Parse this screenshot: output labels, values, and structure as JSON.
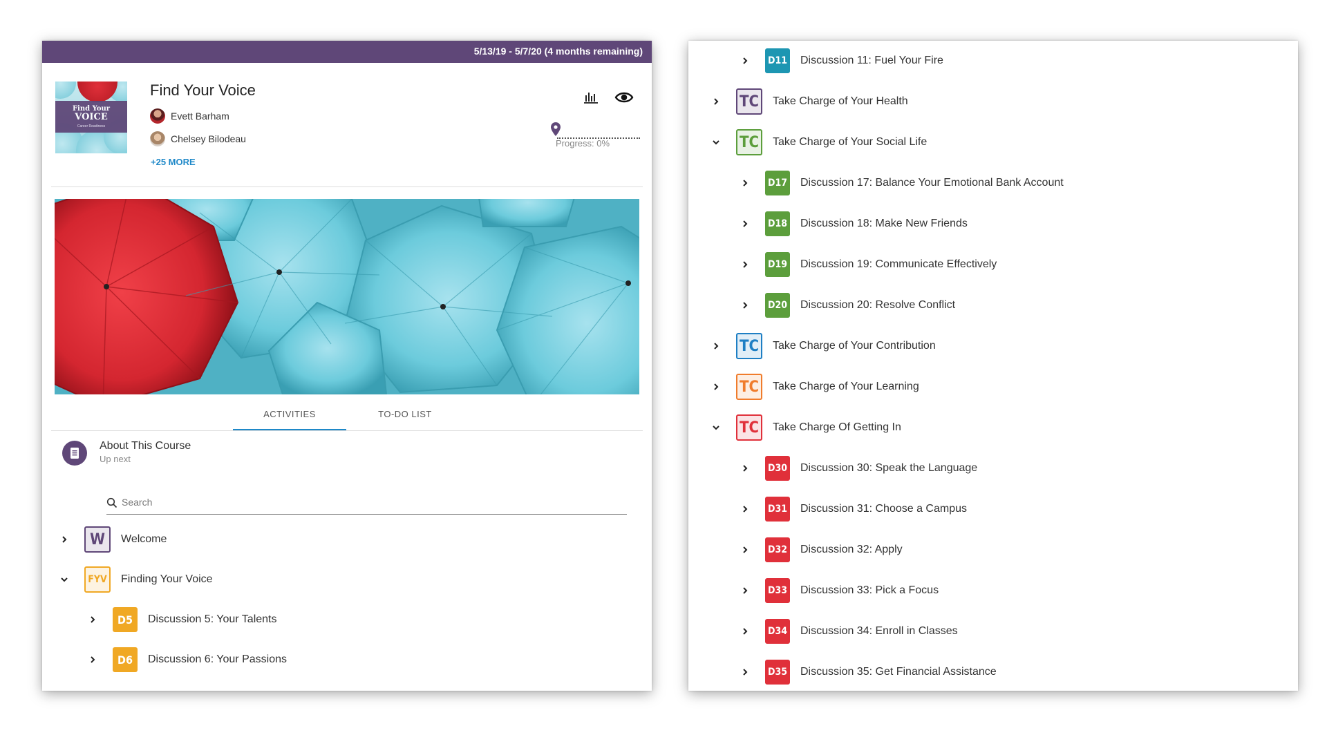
{
  "course": {
    "date_range": "5/13/19 - 5/7/20 (4 months remaining)",
    "title": "Find Your Voice",
    "cover": {
      "line1": "Find Your",
      "line2": "VOICE",
      "line3": "Career Readiness"
    },
    "instructors": [
      "Evett Barham",
      "Chelsey Bilodeau"
    ],
    "more_link": "+25 MORE",
    "progress_label": "Progress: 0%",
    "progress_value": 0
  },
  "tabs": [
    "ACTIVITIES",
    "TO-DO LIST"
  ],
  "up_next": {
    "title": "About This Course",
    "subtitle": "Up next"
  },
  "search": {
    "placeholder": "Search"
  },
  "left_list": [
    {
      "badge": "W",
      "label": "Welcome",
      "expanded": false,
      "level": 0,
      "color": "#5f4778",
      "style": "outline"
    },
    {
      "badge": "FYV",
      "label": "Finding Your Voice",
      "expanded": true,
      "level": 0,
      "color": "#f0a824",
      "style": "outline"
    },
    {
      "badge": "D5",
      "label": "Discussion 5: Your Talents",
      "expanded": false,
      "level": 1,
      "color": "#f0a824",
      "style": "solid"
    },
    {
      "badge": "D6",
      "label": "Discussion 6: Your Passions",
      "expanded": false,
      "level": 1,
      "color": "#f0a824",
      "style": "solid"
    }
  ],
  "right_list": [
    {
      "badge": "D11",
      "label": "Discussion 11: Fuel Your Fire",
      "expanded": false,
      "level": 1,
      "color": "#1d96b2",
      "style": "solid"
    },
    {
      "badge": "TC",
      "label": "Take Charge of Your Health",
      "expanded": false,
      "level": 0,
      "color": "#5f4778",
      "style": "outline"
    },
    {
      "badge": "TC",
      "label": "Take Charge of Your Social Life",
      "expanded": true,
      "level": 0,
      "color": "#5c9e3c",
      "style": "outline"
    },
    {
      "badge": "D17",
      "label": "Discussion 17: Balance Your Emotional Bank Account",
      "expanded": false,
      "level": 1,
      "color": "#5c9e3c",
      "style": "solid"
    },
    {
      "badge": "D18",
      "label": "Discussion 18: Make New Friends",
      "expanded": false,
      "level": 1,
      "color": "#5c9e3c",
      "style": "solid"
    },
    {
      "badge": "D19",
      "label": "Discussion 19: Communicate Effectively",
      "expanded": false,
      "level": 1,
      "color": "#5c9e3c",
      "style": "solid"
    },
    {
      "badge": "D20",
      "label": "Discussion 20: Resolve Conflict",
      "expanded": false,
      "level": 1,
      "color": "#5c9e3c",
      "style": "solid"
    },
    {
      "badge": "TC",
      "label": "Take Charge of Your Contribution",
      "expanded": false,
      "level": 0,
      "color": "#1e7fc4",
      "style": "outline"
    },
    {
      "badge": "TC",
      "label": "Take Charge of Your Learning",
      "expanded": false,
      "level": 0,
      "color": "#f07c2c",
      "style": "outline"
    },
    {
      "badge": "TC",
      "label": "Take Charge Of Getting In",
      "expanded": true,
      "level": 0,
      "color": "#e0303a",
      "style": "outline"
    },
    {
      "badge": "D30",
      "label": "Discussion 30: Speak the Language",
      "expanded": false,
      "level": 1,
      "color": "#e0303a",
      "style": "solid"
    },
    {
      "badge": "D31",
      "label": "Discussion 31: Choose a Campus",
      "expanded": false,
      "level": 1,
      "color": "#e0303a",
      "style": "solid"
    },
    {
      "badge": "D32",
      "label": "Discussion 32: Apply",
      "expanded": false,
      "level": 1,
      "color": "#e0303a",
      "style": "solid"
    },
    {
      "badge": "D33",
      "label": "Discussion 33: Pick a Focus",
      "expanded": false,
      "level": 1,
      "color": "#e0303a",
      "style": "solid"
    },
    {
      "badge": "D34",
      "label": "Discussion 34: Enroll in Classes",
      "expanded": false,
      "level": 1,
      "color": "#e0303a",
      "style": "solid"
    },
    {
      "badge": "D35",
      "label": "Discussion 35: Get Financial Assistance",
      "expanded": false,
      "level": 1,
      "color": "#e0303a",
      "style": "solid"
    }
  ]
}
